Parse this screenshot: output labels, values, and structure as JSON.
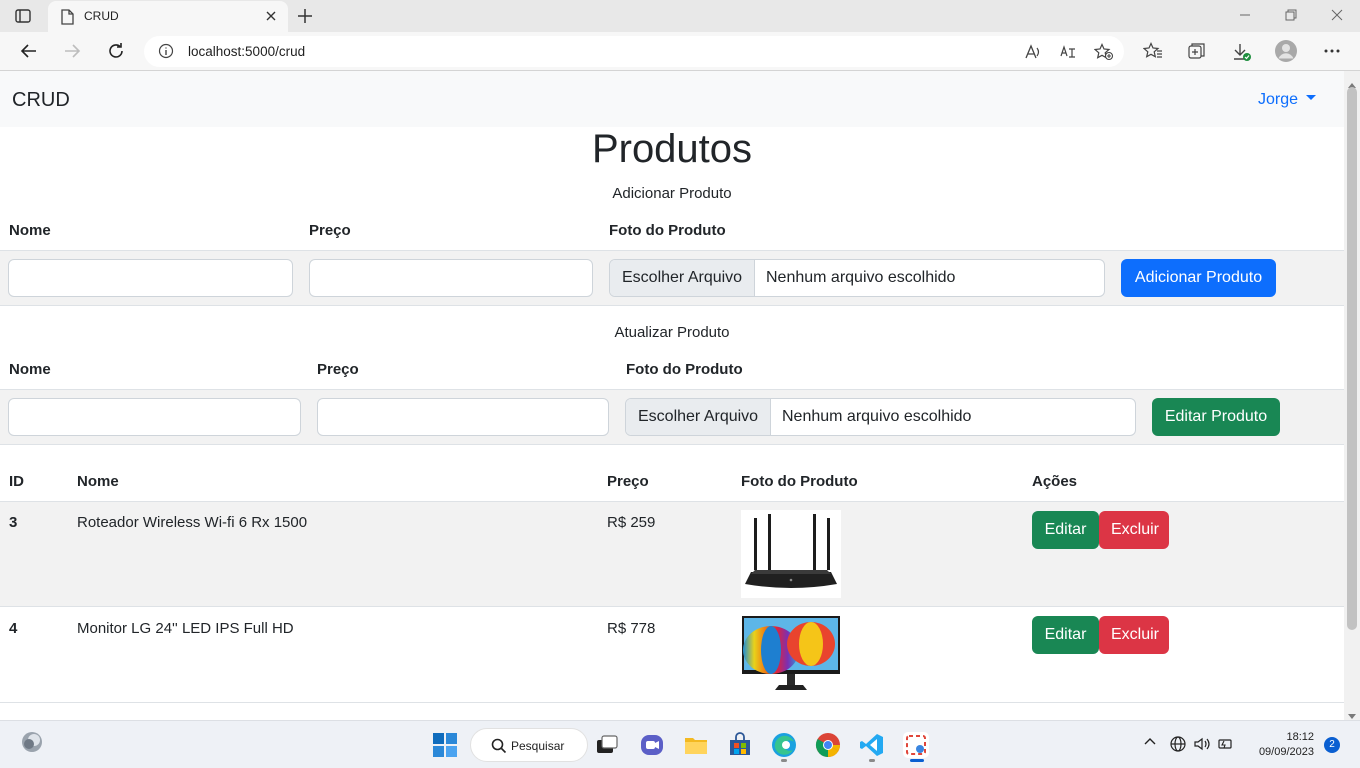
{
  "browser": {
    "tab_title": "CRUD",
    "url_host": "localhost",
    "url_rest": ":5000/crud"
  },
  "navbar": {
    "brand": "CRUD",
    "user": "Jorge"
  },
  "page": {
    "title": "Produtos",
    "add_section": {
      "heading": "Adicionar Produto",
      "label_name": "Nome",
      "label_price": "Preço",
      "label_photo": "Foto do Produto",
      "file_button": "Escolher Arquivo",
      "file_status": "Nenhum arquivo escolhido",
      "submit_label": "Adicionar Produto"
    },
    "update_section": {
      "heading": "Atualizar Produto",
      "label_name": "Nome",
      "label_price": "Preço",
      "label_photo": "Foto do Produto",
      "file_button": "Escolher Arquivo",
      "file_status": "Nenhum arquivo escolhido",
      "submit_label": "Editar Produto"
    },
    "table": {
      "headers": [
        "ID",
        "Nome",
        "Preço",
        "Foto do Produto",
        "Ações"
      ],
      "rows": [
        {
          "id": "3",
          "name": "Roteador Wireless Wi-fi 6 Rx 1500",
          "price": "R$ 259",
          "photo": "router-image",
          "edit": "Editar",
          "delete": "Excluir"
        },
        {
          "id": "4",
          "name": "Monitor LG 24'' LED IPS Full HD",
          "price": "R$ 778",
          "photo": "monitor-image",
          "edit": "Editar",
          "delete": "Excluir"
        }
      ]
    }
  },
  "taskbar": {
    "search_label": "Pesquisar",
    "time": "18:12",
    "date": "09/09/2023",
    "notifications": "2"
  },
  "colors": {
    "primary": "#0d6efd",
    "success": "#198754",
    "danger": "#dc3545"
  }
}
